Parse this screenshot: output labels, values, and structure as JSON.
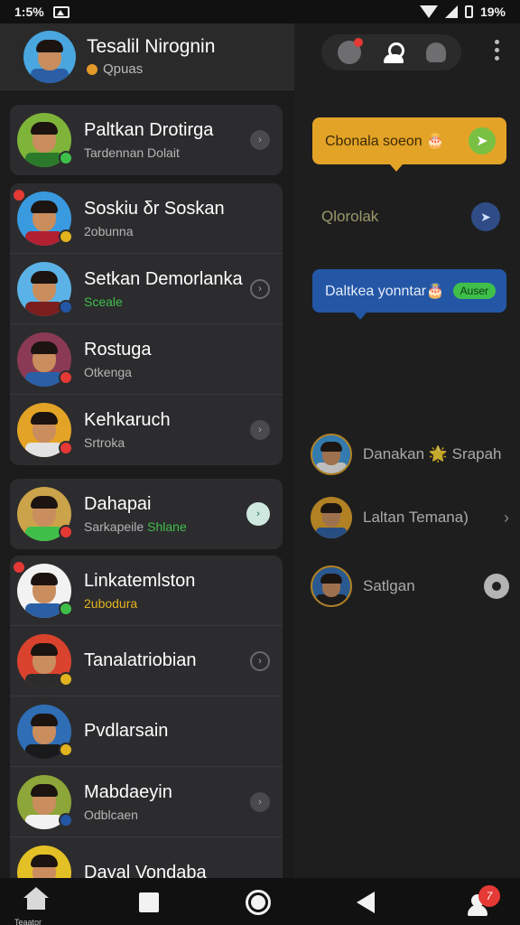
{
  "status_bar": {
    "time": "1:5%",
    "battery": "19%"
  },
  "profile": {
    "name": "Tesalil Nirognin",
    "subtitle": "Qpuas"
  },
  "chats": [
    {
      "name": "Paltkan Drotirga",
      "sub": "Tardennan Dolait",
      "sub_style": "normal",
      "shirt": "#2b7a2b",
      "bg": "#7fb43a",
      "badge": "#3fbf4a",
      "tl": "",
      "chev": "filled"
    },
    {
      "name": "Soskiu δr Soskan",
      "sub": "2obunna",
      "sub_style": "normal",
      "shirt": "#b02030",
      "bg": "#3a9ae0",
      "badge": "#e2b31f",
      "tl": "#e53935",
      "chev": ""
    },
    {
      "name": "Setkan Demorlanka",
      "sub": "Sceale",
      "sub_style": "green",
      "shirt": "#7a1e1e",
      "bg": "#5bb2e6",
      "badge": "#2357a6",
      "tl": "",
      "chev": "outline"
    },
    {
      "name": "Rostuga",
      "sub": "Otkenga",
      "sub_style": "normal",
      "shirt": "#2a5fa5",
      "bg": "#8b3a55",
      "badge": "#e53935",
      "tl": "",
      "chev": ""
    },
    {
      "name": "Kehkaruch",
      "sub": "Srtroka",
      "sub_style": "normal",
      "shirt": "#e2e2e2",
      "bg": "#e3a326",
      "badge": "#e53935",
      "tl": "",
      "chev": "filled"
    },
    {
      "name": "Dahapai",
      "sub": "Sarkapeile",
      "sub_extra": "Shlane",
      "sub_style": "normal",
      "shirt": "#3fbf4a",
      "bg": "#caa34a",
      "badge": "#e53935",
      "tl": "",
      "chev": "wa"
    },
    {
      "name": "Linkatemlston",
      "sub": "2ubodura",
      "sub_style": "yellow",
      "shirt": "#2a5fa5",
      "bg": "#f2f2f2",
      "badge": "#3fbf4a",
      "tl": "#e53935",
      "chev": ""
    },
    {
      "name": "Tanalatriobian",
      "sub": "",
      "sub_style": "normal",
      "shirt": "#2c2c2c",
      "bg": "#d9432e",
      "badge": "#e2b31f",
      "tl": "",
      "chev": "outline"
    },
    {
      "name": "Pvdlarsain",
      "sub": "",
      "sub_style": "normal",
      "shirt": "#1a1a1a",
      "bg": "#2f6db5",
      "badge": "#e2b31f",
      "tl": "",
      "chev": ""
    },
    {
      "name": "Mabdaeyin",
      "sub": "Odblcaen",
      "sub_style": "normal",
      "shirt": "#f2f2f2",
      "bg": "#8da63a",
      "badge": "#2357a6",
      "tl": "",
      "chev": "filled"
    },
    {
      "name": "Dayal Vondaba",
      "sub": "",
      "sub_style": "normal",
      "shirt": "#b02030",
      "bg": "#e3c026",
      "badge": "",
      "tl": "",
      "chev": ""
    }
  ],
  "right": {
    "bubble_orange": "Cbonala soeon 🎂",
    "message_plain": "Qlorolak",
    "bubble_blue": "Daltkea yonntar🎂",
    "bubble_blue_pill": "Auser",
    "contacts": [
      {
        "name": "Danakan 🌟 Srapah",
        "trail": ""
      },
      {
        "name": "Laltan Temana)",
        "trail": "›"
      },
      {
        "name": "Satlgan",
        "trail": "gear"
      }
    ]
  },
  "nav": {
    "home_label": "Teaator",
    "profile_badge": "7"
  },
  "colors": {
    "orange_bubble": "#e3a326",
    "blue_bubble": "#2357a6",
    "green": "#3fbf4a",
    "red": "#e53935"
  }
}
